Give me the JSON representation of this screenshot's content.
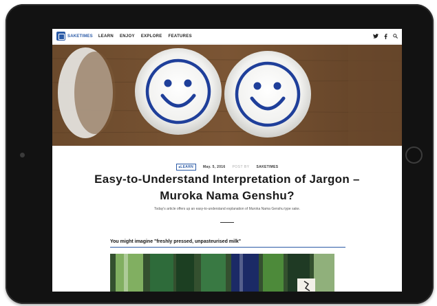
{
  "site": {
    "logo_text": "SAKETIMES",
    "nav": [
      "LEARN",
      "ENJOY",
      "EXPLORE",
      "FEATURES"
    ],
    "icons": [
      "twitter-icon",
      "facebook-icon",
      "search-icon"
    ]
  },
  "hero": {
    "alt": "Two sake cups with blue smiley faces"
  },
  "article": {
    "tag": "LEARN",
    "date": "May. 5, 2016",
    "posted_by_label": "POST BY",
    "author": "SAKETIMES",
    "title": "Easy-to-Understand Interpretation of Jargon – Muroka Nama Genshu?",
    "subtitle": "Today's article offers up an easy-to-understand explanation of Muroka Nama Genshu type sake.",
    "section_heading": "You might imagine \"freshly pressed, unpasteurised milk\""
  },
  "colors": {
    "accent": "#2a5aa6",
    "tablet_bezel": "#121212"
  }
}
